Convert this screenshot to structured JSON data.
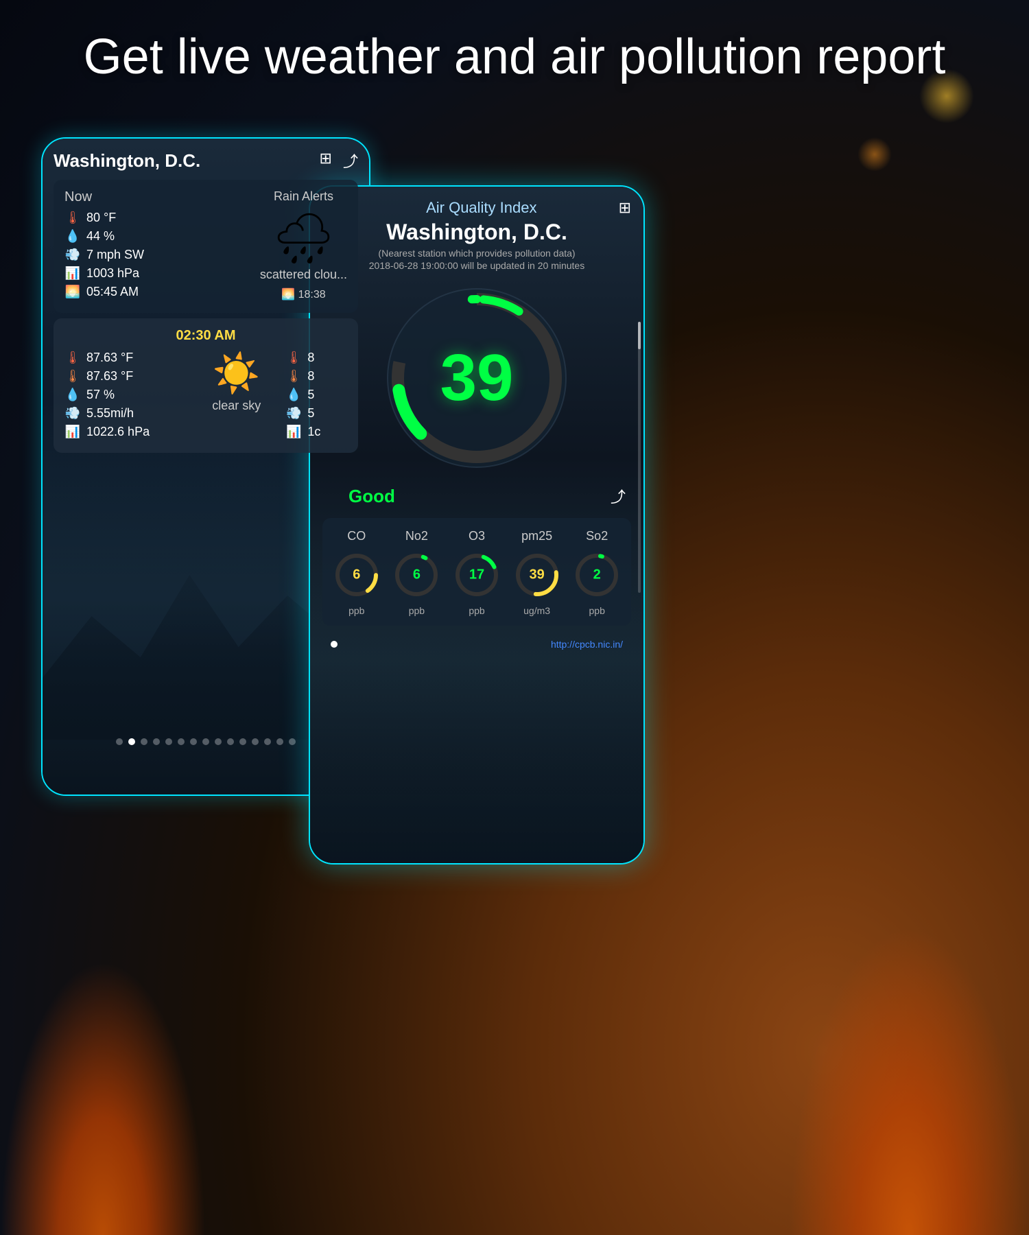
{
  "header": {
    "title": "Get live weather and air pollution report"
  },
  "weather_phone": {
    "city": "Washington, D.C.",
    "now_label": "Now",
    "temperature": "80 °F",
    "humidity": "44 %",
    "wind": "7 mph SW",
    "pressure": "1003 hPa",
    "sunrise": "05:45 AM",
    "sunset": "18:38",
    "rain_alerts": "Rain Alerts",
    "condition": "scattered clou...",
    "forecast_time": "02:30 AM",
    "forecast_temp": "87.63 °F",
    "forecast_feels": "87.63 °F",
    "forecast_humidity": "57 %",
    "forecast_wind": "5.55mi/h",
    "forecast_pressure": "1022.6 hPa",
    "forecast_condition": "clear sky",
    "forecast_temp2": "8",
    "forecast_temp3": "8",
    "forecast_humidity2": "5",
    "forecast_wind2": "5",
    "forecast_pressure2": "1c",
    "page_dots_count": 15,
    "page_dots_active": 1
  },
  "aqi_phone": {
    "title": "Air Quality Index",
    "city": "Washington, D.C.",
    "station_note": "(Nearest station which provides pollution data)",
    "timestamp": "2018-06-28 19:00:00 will be updated in 20 minutes",
    "aqi_value": "39",
    "status": "Good",
    "pollutants": [
      {
        "label": "CO",
        "value": "6",
        "unit": "ppb",
        "color": "#ffdd44",
        "arc_pct": 0.15
      },
      {
        "label": "No2",
        "value": "6",
        "unit": "ppb",
        "color": "#00ff44",
        "arc_pct": 0.15
      },
      {
        "label": "O3",
        "value": "17",
        "unit": "ppb",
        "color": "#00ff44",
        "arc_pct": 0.25
      },
      {
        "label": "pm25",
        "value": "39",
        "unit": "ug/m3",
        "color": "#ffdd44",
        "arc_pct": 0.45
      },
      {
        "label": "So2",
        "value": "2",
        "unit": "ppb",
        "color": "#00ff44",
        "arc_pct": 0.05
      }
    ],
    "source_link": "http://cpcb.nic.in/",
    "page_dot_active": 0
  },
  "icons": {
    "grid_icon": "⊞",
    "share_icon": "⋮",
    "share_icon2": "⋮",
    "cloud_emoji": "🌧",
    "sun_emoji": "☀",
    "thermometer": "🌡",
    "humidity": "💧",
    "wind": "💨",
    "pressure": "📊",
    "sunrise": "🌅"
  }
}
